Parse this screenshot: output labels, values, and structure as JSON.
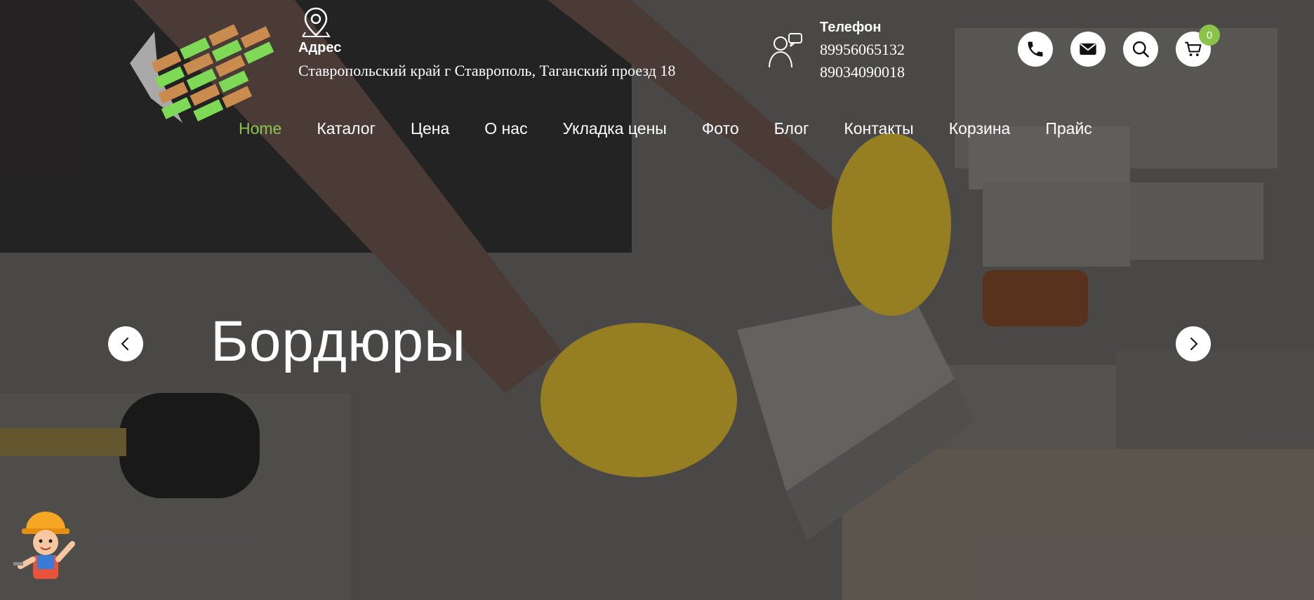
{
  "header": {
    "address_title": "Адрес",
    "address_text": "Ставропольский край г Ставрополь, Таганский проезд 18",
    "phone_title": "Телефон",
    "phone_1": "89956065132",
    "phone_2": "89034090018",
    "cart_count": "0",
    "icons": [
      "map-pin-icon",
      "operator-icon",
      "phone-icon",
      "mail-icon",
      "search-icon",
      "cart-icon"
    ]
  },
  "nav": {
    "items": [
      "Home",
      "Каталог",
      "Цена",
      "О нас",
      "Укладка цены",
      "Фото",
      "Блог",
      "Контакты",
      "Корзина",
      "Прайс"
    ],
    "active": "Home"
  },
  "slider": {
    "title": "Бордюры"
  },
  "colors": {
    "accent": "#8bc34a",
    "brick_orange": "#c98b4e",
    "brick_green": "#7ed957"
  }
}
